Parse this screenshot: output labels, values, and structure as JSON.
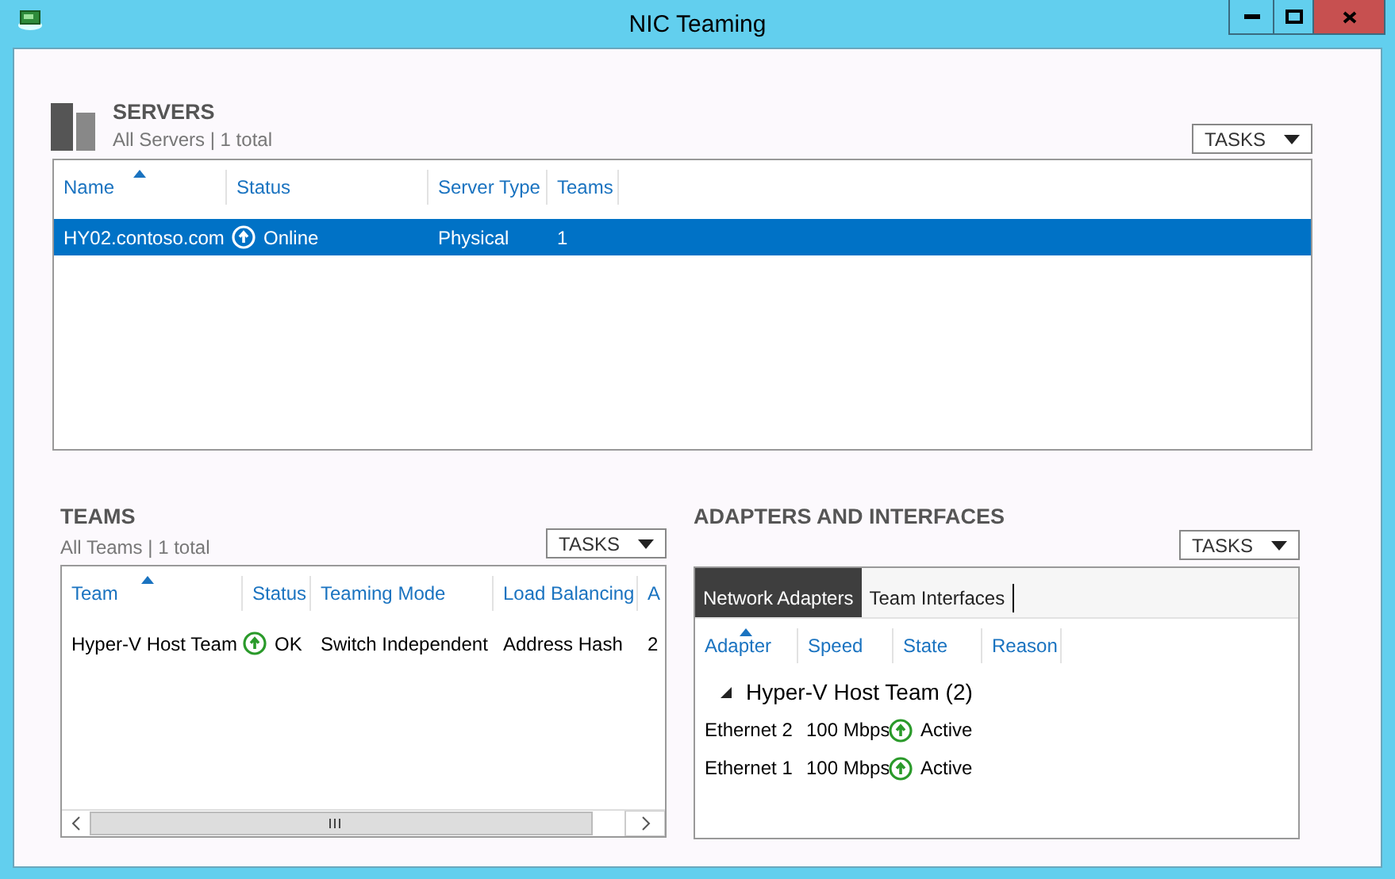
{
  "window": {
    "title": "NIC Teaming"
  },
  "servers": {
    "title": "SERVERS",
    "subtitle": "All Servers | 1 total",
    "tasks": "TASKS",
    "columns": [
      {
        "label": "Name",
        "sorted": true
      },
      {
        "label": "Status",
        "sorted": false
      },
      {
        "label": "Server Type",
        "sorted": false
      },
      {
        "label": "Teams",
        "sorted": false
      }
    ],
    "rows": [
      {
        "name": "HY02.contoso.com",
        "status": "Online",
        "server_type": "Physical",
        "teams": "1",
        "selected": true
      }
    ]
  },
  "teams": {
    "title": "TEAMS",
    "subtitle": "All Teams | 1 total",
    "tasks": "TASKS",
    "columns": [
      {
        "label": "Team",
        "sorted": true
      },
      {
        "label": "Status",
        "sorted": false
      },
      {
        "label": "Teaming Mode",
        "sorted": false
      },
      {
        "label": "Load Balancing",
        "sorted": false
      },
      {
        "label": "A",
        "sorted": false
      }
    ],
    "rows": [
      {
        "team": "Hyper-V Host Team",
        "status": "OK",
        "teaming_mode": "Switch Independent",
        "load_balancing": "Address Hash",
        "column_5": "2",
        "selected": false
      }
    ]
  },
  "adapters": {
    "title": "ADAPTERS AND INTERFACES",
    "tasks": "TASKS",
    "tabs": [
      {
        "label": "Network Adapters",
        "selected": true
      },
      {
        "label": "Team Interfaces",
        "selected": false
      }
    ],
    "columns": [
      {
        "label": "Adapter",
        "sorted": true
      },
      {
        "label": "Speed",
        "sorted": false
      },
      {
        "label": "State",
        "sorted": false
      },
      {
        "label": "Reason",
        "sorted": false
      }
    ],
    "groups": [
      {
        "label": "Hyper-V Host Team (2)",
        "expanded": true,
        "children": [
          {
            "adapter": "Ethernet 2",
            "speed": "100 Mbps",
            "state": "Active"
          },
          {
            "adapter": "Ethernet 1",
            "speed": "100 Mbps",
            "state": "Active"
          }
        ]
      }
    ]
  }
}
